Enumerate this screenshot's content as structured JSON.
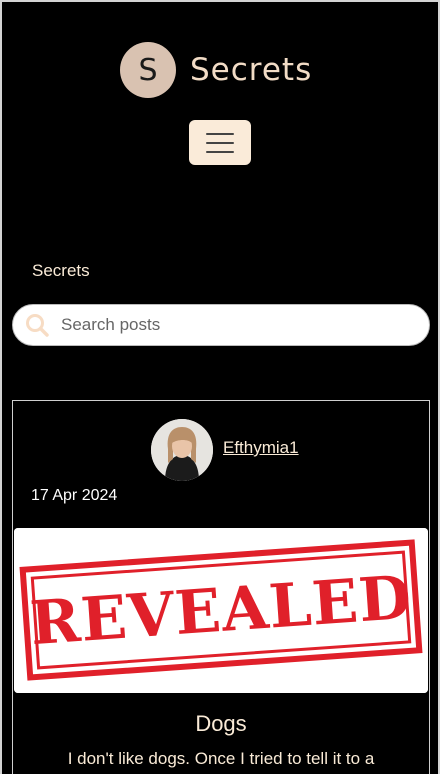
{
  "header": {
    "logo_letter": "S",
    "brand_title": "Secrets",
    "menu_icon": "hamburger-icon"
  },
  "section": {
    "label": "Secrets"
  },
  "search": {
    "placeholder": "Search posts",
    "icon": "search-icon"
  },
  "post": {
    "author": "Efthymia1",
    "date": "17 Apr 2024",
    "image_stamp_text": "REVEALED",
    "title": "Dogs",
    "excerpt": "I don't like dogs. Once I tried to tell it to a"
  },
  "colors": {
    "background": "#000000",
    "accent": "#faebd7",
    "stamp_red": "#e0202a"
  }
}
